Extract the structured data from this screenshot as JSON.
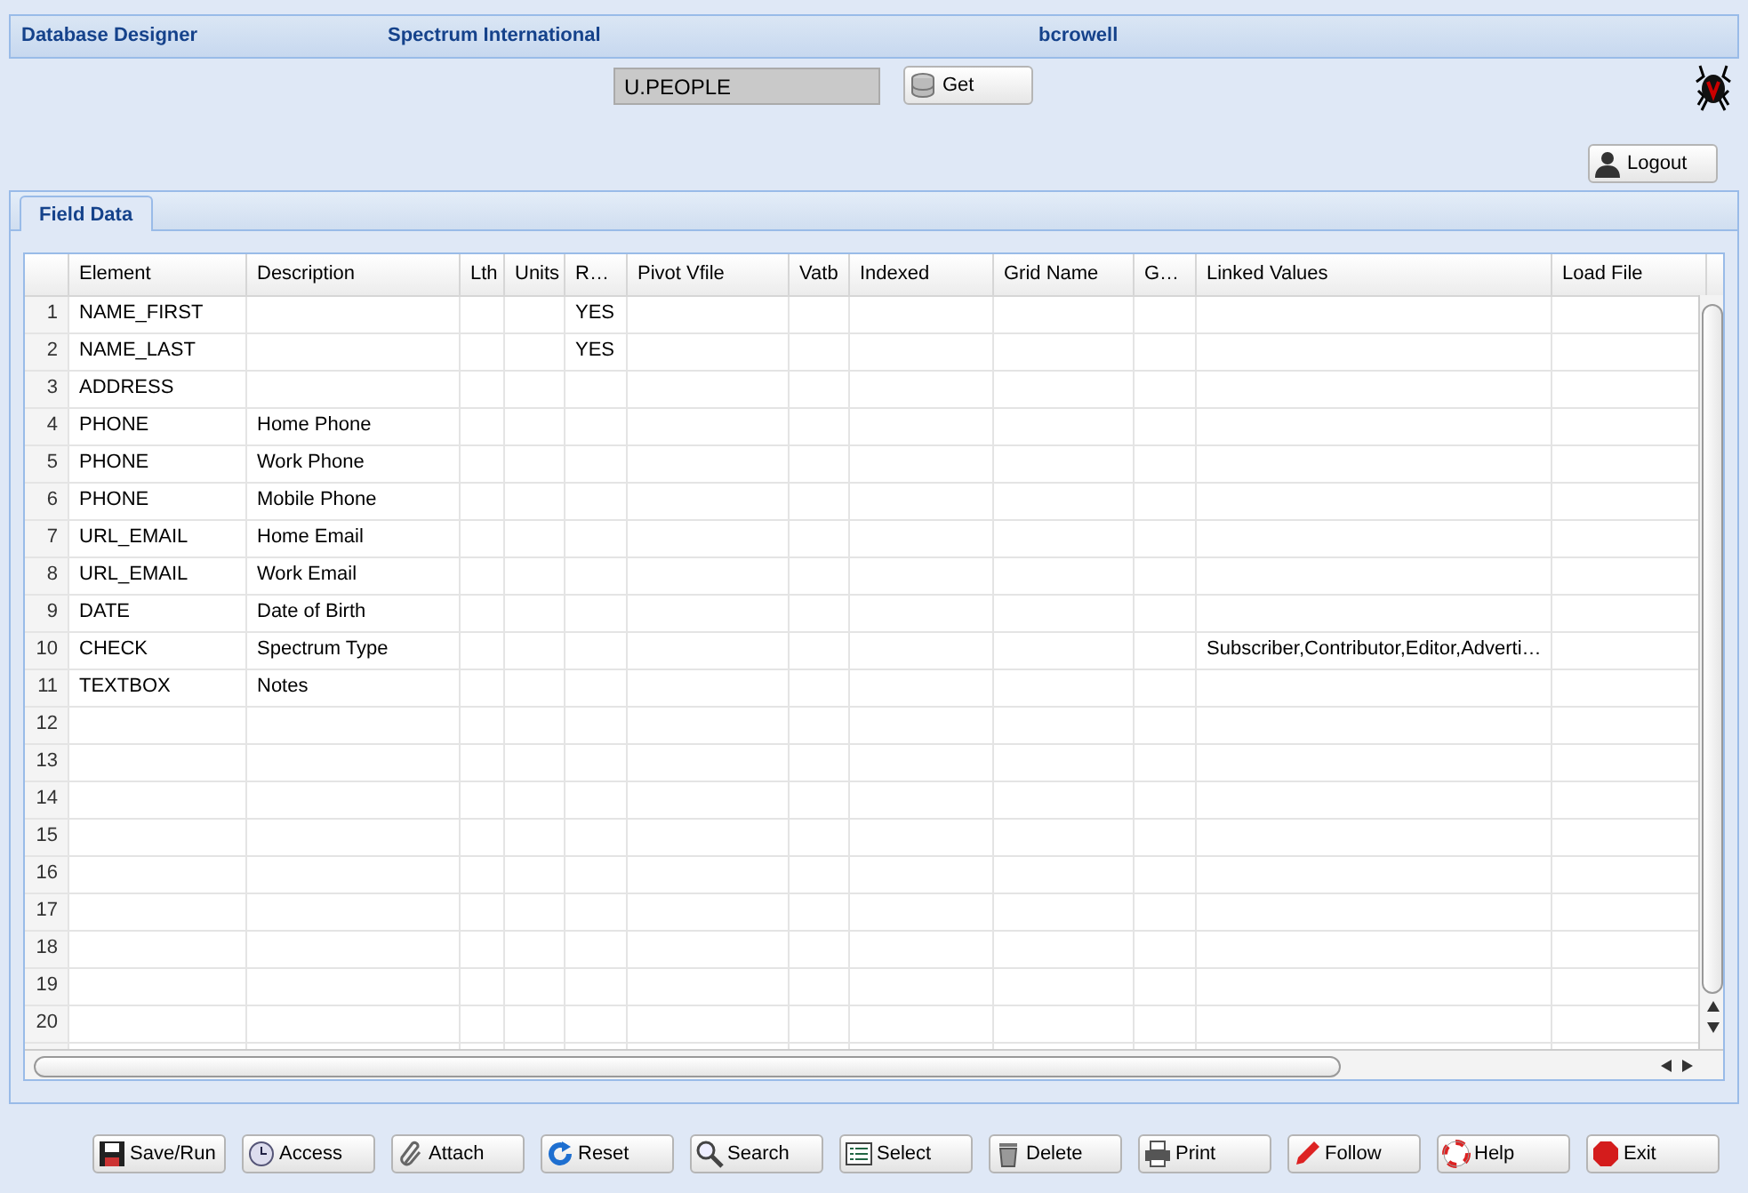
{
  "header": {
    "app": "Database Designer",
    "company": "Spectrum International",
    "user": "bcrowell"
  },
  "file_field": {
    "value": "U.PEOPLE"
  },
  "get_button": {
    "label": "Get"
  },
  "logout_button": {
    "label": "Logout"
  },
  "tabs": [
    {
      "label": "Field Data",
      "selected": true
    }
  ],
  "table": {
    "columns": [
      "Element",
      "Description",
      "Lth",
      "Units",
      "R…",
      "Pivot Vfile",
      "Vatb",
      "Indexed",
      "Grid Name",
      "G…",
      "Linked Values",
      "Load File"
    ],
    "rows": [
      {
        "number": "1",
        "cells": [
          "NAME_FIRST",
          null,
          null,
          null,
          "YES"
        ]
      },
      {
        "number": "2",
        "cells": [
          "NAME_LAST",
          null,
          null,
          null,
          "YES"
        ]
      },
      {
        "number": "3",
        "cells": [
          "ADDRESS"
        ]
      },
      {
        "number": "4",
        "cells": [
          "PHONE",
          "Home Phone"
        ]
      },
      {
        "number": "5",
        "cells": [
          "PHONE",
          "Work Phone"
        ]
      },
      {
        "number": "6",
        "cells": [
          "PHONE",
          "Mobile Phone"
        ]
      },
      {
        "number": "7",
        "cells": [
          "URL_EMAIL",
          "Home Email"
        ]
      },
      {
        "number": "8",
        "cells": [
          "URL_EMAIL",
          "Work Email"
        ]
      },
      {
        "number": "9",
        "cells": [
          "DATE",
          "Date of Birth"
        ]
      },
      {
        "number": "10",
        "cells": [
          "CHECK",
          "Spectrum Type",
          null,
          null,
          null,
          null,
          null,
          null,
          null,
          null,
          "Subscriber,Contributor,Editor,Adverti…"
        ]
      },
      {
        "number": "11",
        "cells": [
          "TEXTBOX",
          "Notes"
        ]
      },
      {
        "number": "12"
      },
      {
        "number": "13"
      },
      {
        "number": "14"
      },
      {
        "number": "15"
      },
      {
        "number": "16"
      },
      {
        "number": "17"
      },
      {
        "number": "18"
      },
      {
        "number": "19"
      },
      {
        "number": "20"
      }
    ]
  },
  "buttons": [
    {
      "label": "Save/Run"
    },
    {
      "label": "Access"
    },
    {
      "label": "Attach"
    },
    {
      "label": "Reset"
    },
    {
      "label": "Search"
    },
    {
      "label": "Select"
    },
    {
      "label": "Delete"
    },
    {
      "label": "Print"
    },
    {
      "label": "Follow"
    },
    {
      "label": "Help"
    },
    {
      "label": "Exit"
    }
  ]
}
